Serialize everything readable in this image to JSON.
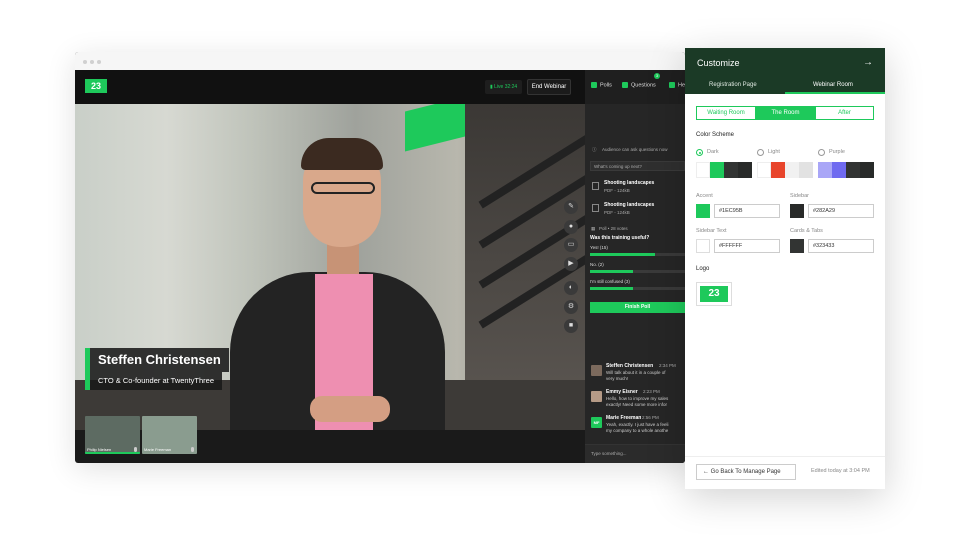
{
  "app": {
    "logo_text": "23",
    "live_status": "Live 32:24",
    "end_button": "End Webinar"
  },
  "speaker": {
    "name": "Steffen Christensen",
    "role": "CTO & Co-founder at TwentyThree"
  },
  "participants": [
    {
      "name": "Philip Nielsen"
    },
    {
      "name": "Marie Freeman"
    }
  ],
  "side_tabs": {
    "polls": "Polls",
    "questions": "Questions",
    "questions_count": "3",
    "more": "He"
  },
  "questions_panel": {
    "notice": "Audience can ask questions now",
    "placeholder": "What's coming up next?"
  },
  "files": [
    {
      "title": "Shooting landscapes",
      "meta": "PDF - 124kB"
    },
    {
      "title": "Shooting landscapes",
      "meta": "PDF - 124kB"
    }
  ],
  "poll": {
    "header": "Poll • 28 votes",
    "question": "Was this training useful?",
    "options": [
      {
        "label": "Yes! (15)",
        "fraction": 0.68
      },
      {
        "label": "No. (2)",
        "fraction": 0.45
      },
      {
        "label": "I'm still confused (3)",
        "fraction": 0.45
      }
    ],
    "finish_button": "Finish Poll"
  },
  "chat": [
    {
      "name": "Steffen Christensen",
      "time": "2:34 PM",
      "line1": "Will talk about it in a couple of",
      "line2": "very much!"
    },
    {
      "name": "Emmy Eisner",
      "time": "2:23 PM",
      "line1": "Hello, how to improve my sales",
      "line2": "exactly! Need some more infor"
    },
    {
      "name": "Marie Freeman",
      "time": "2:56 PM",
      "initials": "MF",
      "line1": "Yeah, exactly. I just have a feeli",
      "line2": "my company to a whole anothe"
    }
  ],
  "chat_input": {
    "placeholder": "Type something..."
  },
  "customize": {
    "title": "Customize",
    "tabs": [
      "Registration Page",
      "Webinar Room"
    ],
    "segments": [
      "Waiting Room",
      "The Room",
      "After"
    ],
    "color_scheme_label": "Color Scheme",
    "schemes": [
      {
        "label": "Dark",
        "selected": true
      },
      {
        "label": "Light",
        "selected": false
      },
      {
        "label": "Purple",
        "selected": false
      }
    ],
    "fields": {
      "accent_label": "Accent",
      "accent_value": "#1EC95B",
      "sidebar_label": "Sidebar",
      "sidebar_value": "#282A29",
      "sidebar_text_label": "Sidebar Text",
      "sidebar_text_value": "#FFFFFF",
      "cards_label": "Cards & Tabs",
      "cards_value": "#323433"
    },
    "logo_label": "Logo",
    "logo_text": "23",
    "back_button": "Go Back To Manage Page",
    "edited": "Edited today at 3:04 PM"
  },
  "colors": {
    "accent": "#1EC95B",
    "header": "#1B3A26",
    "dark": "#1A1A1A"
  }
}
